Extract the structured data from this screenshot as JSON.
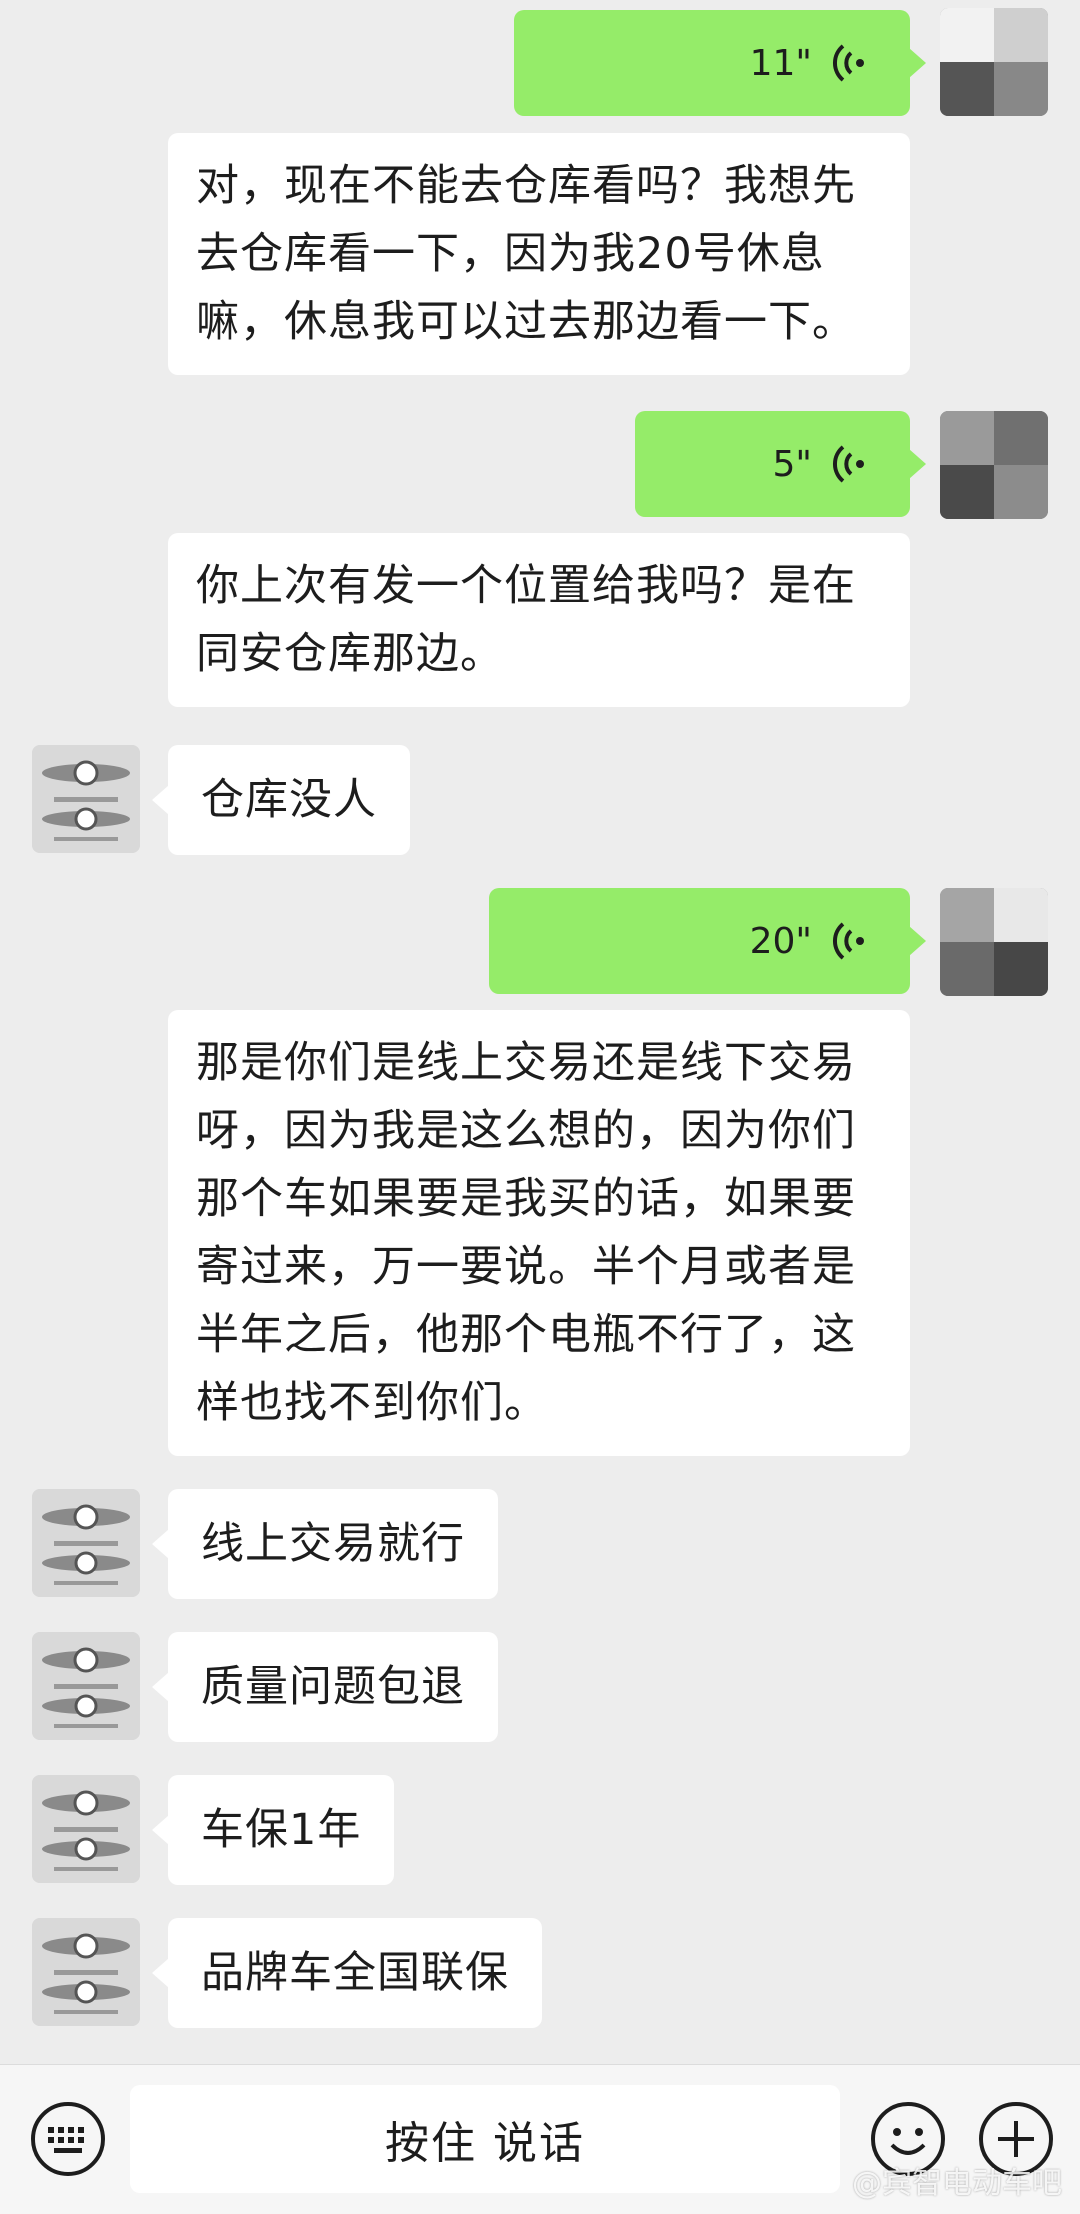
{
  "messages": [
    {
      "side": "right",
      "type": "voice",
      "duration": "11\""
    },
    {
      "side": "right",
      "type": "text",
      "text": "对，现在不能去仓库看吗？我想先去仓库看一下，因为我20号休息嘛，休息我可以过去那边看一下。"
    },
    {
      "side": "right",
      "type": "voice",
      "duration": "5\""
    },
    {
      "side": "right",
      "type": "text",
      "text": "你上次有发一个位置给我吗？是在同安仓库那边。"
    },
    {
      "side": "left",
      "type": "text",
      "text": "仓库没人"
    },
    {
      "side": "right",
      "type": "voice",
      "duration": "20\""
    },
    {
      "side": "right",
      "type": "text",
      "text": "那是你们是线上交易还是线下交易呀，因为我是这么想的，因为你们那个车如果要是我买的话，如果要寄过来，万一要说。半个月或者是半年之后，他那个电瓶不行了，这样也找不到你们。"
    },
    {
      "side": "left",
      "type": "text",
      "text": "线上交易就行"
    },
    {
      "side": "left",
      "type": "text",
      "text": "质量问题包退"
    },
    {
      "side": "left",
      "type": "text",
      "text": "车保1年"
    },
    {
      "side": "left",
      "type": "text",
      "text": "品牌车全国联保"
    }
  ],
  "input_bar": {
    "talk_label": "按住 说话",
    "keyboard_icon": "keyboard-icon",
    "emoji_icon": "emoji-icon",
    "plus_icon": "plus-icon"
  },
  "watermark": "@宾智电动车吧",
  "colors": {
    "background": "#ededed",
    "self_bubble": "#95ec69",
    "other_bubble": "#ffffff"
  }
}
